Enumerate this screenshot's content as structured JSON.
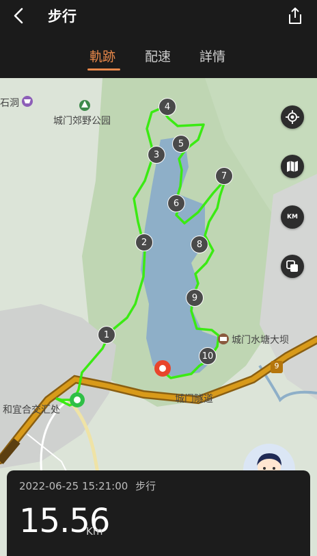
{
  "header": {
    "title": "步行",
    "back_icon": "chevron-left-icon",
    "share_icon": "share-icon"
  },
  "tabs": [
    {
      "label": "軌跡",
      "active": true
    },
    {
      "label": "配速",
      "active": false
    },
    {
      "label": "詳情",
      "active": false
    }
  ],
  "map": {
    "labels": {
      "cave": "石洞",
      "park": "城门郊野公园",
      "dam": "城门水塘大坝",
      "tunnel": "城门隧道",
      "junction": "和宜合交汇处"
    },
    "route_badge": "9",
    "waypoints": [
      "1",
      "2",
      "3",
      "4",
      "5",
      "6",
      "7",
      "8",
      "9",
      "10"
    ],
    "controls": {
      "locate_icon": "locate-icon",
      "map_icon": "map-layers-icon",
      "unit_label": "KM",
      "layers_icon": "copy-layers-icon"
    },
    "colors": {
      "track": "#3bea13",
      "start": "#2fbf46",
      "end": "#e8452b"
    }
  },
  "summary": {
    "datetime": "2022-06-25 15:21:00",
    "activity": "步行",
    "distance": "15.56",
    "unit": "Km"
  }
}
